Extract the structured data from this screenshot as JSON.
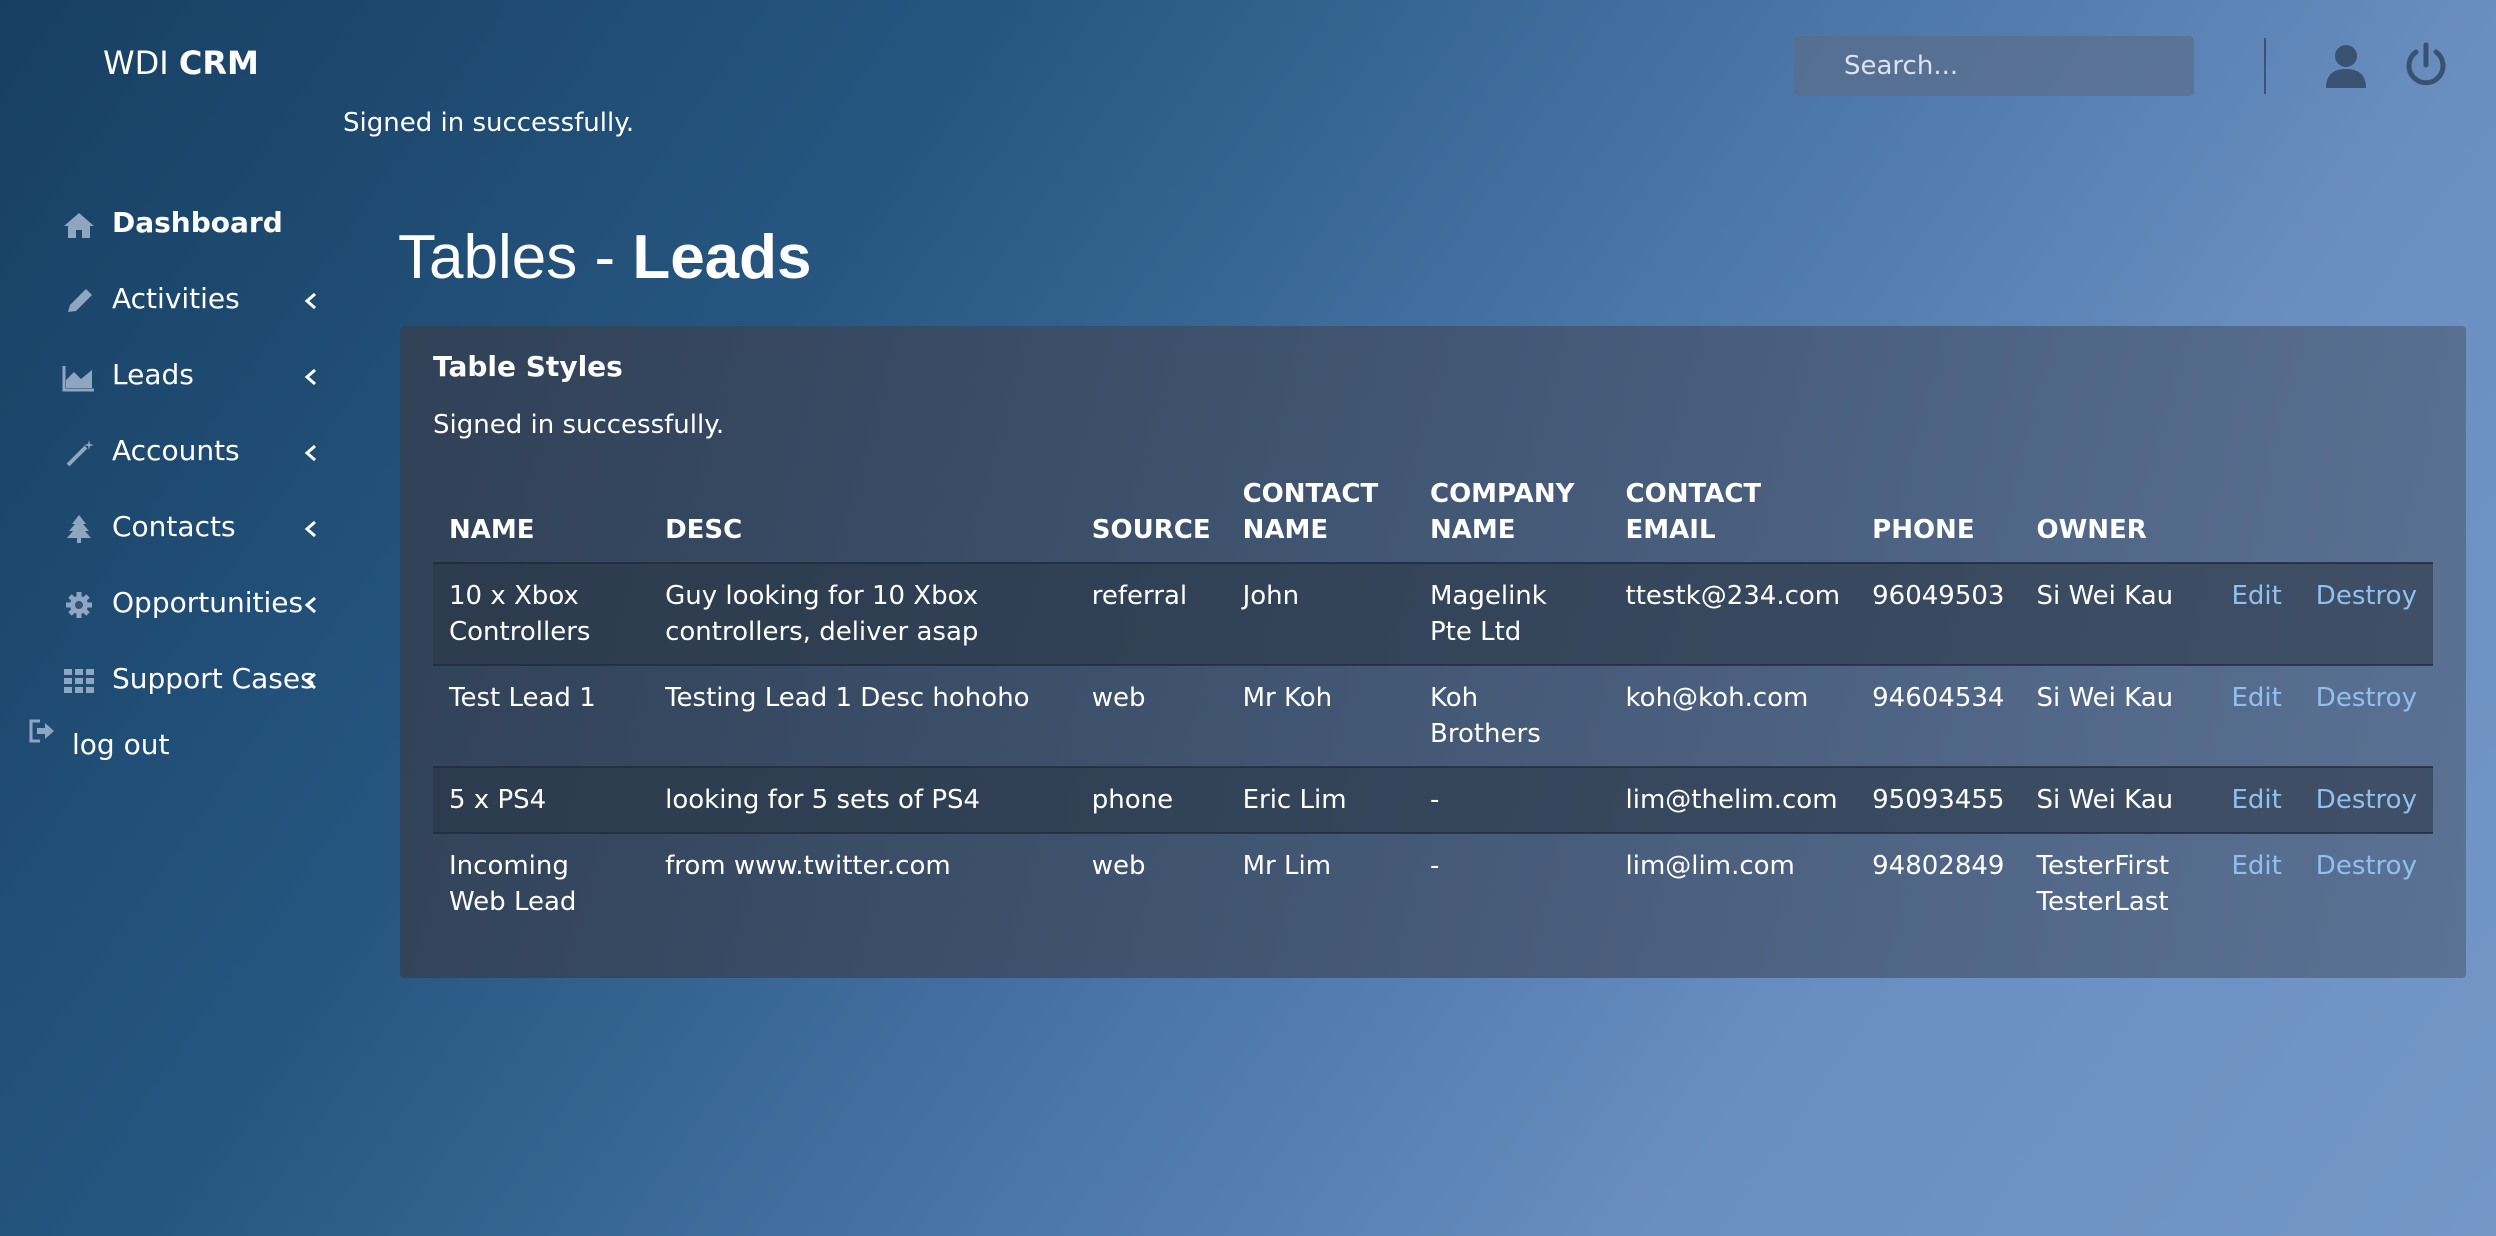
{
  "brand": {
    "prefix": "WDI ",
    "bold": "CRM"
  },
  "top_flash": "Signed in successfully.",
  "search": {
    "placeholder": "Search..."
  },
  "sidebar": {
    "items": [
      {
        "label": "Dashboard",
        "icon": "home-icon"
      },
      {
        "label": "Activities",
        "icon": "pencil-icon"
      },
      {
        "label": "Leads",
        "icon": "area-chart-icon"
      },
      {
        "label": "Accounts",
        "icon": "magic-wand-icon"
      },
      {
        "label": "Contacts",
        "icon": "tree-icon"
      },
      {
        "label": "Opportunities",
        "icon": "gear-icon"
      },
      {
        "label": "Support Cases",
        "icon": "grid-icon"
      }
    ],
    "logout": "log out"
  },
  "page_title": {
    "prefix": "Tables - ",
    "bold": "Leads"
  },
  "panel": {
    "title": "Table Styles",
    "flash": "Signed in successfully."
  },
  "table": {
    "headers": {
      "name": "NAME",
      "desc": "DESC",
      "source": "SOURCE",
      "contact_name": "CONTACT NAME",
      "company_name": "COMPANY NAME",
      "contact_email": "CONTACT EMAIL",
      "phone": "PHONE",
      "owner": "OWNER"
    },
    "rows": [
      {
        "name": "10 x Xbox Controllers",
        "desc": "Guy looking for 10 Xbox controllers, deliver asap",
        "source": "referral",
        "contact_name": "John",
        "company_name": "Magelink Pte Ltd",
        "contact_email": "ttestk@234.com",
        "phone": "96049503",
        "owner": "Si Wei Kau",
        "edit": "Edit",
        "destroy": "Destroy"
      },
      {
        "name": "Test Lead 1",
        "desc": "Testing Lead 1 Desc hohoho",
        "source": "web",
        "contact_name": "Mr Koh",
        "company_name": "Koh Brothers",
        "contact_email": "koh@koh.com",
        "phone": "94604534",
        "owner": "Si Wei Kau",
        "edit": "Edit",
        "destroy": "Destroy"
      },
      {
        "name": "5 x PS4",
        "desc": "looking for 5 sets of PS4",
        "source": "phone",
        "contact_name": "Eric Lim",
        "company_name": "-",
        "contact_email": "lim@thelim.com",
        "phone": "95093455",
        "owner": "Si Wei Kau",
        "edit": "Edit",
        "destroy": "Destroy"
      },
      {
        "name": "Incoming Web Lead",
        "desc": "from www.twitter.com",
        "source": "web",
        "contact_name": "Mr Lim",
        "company_name": "-",
        "contact_email": "lim@lim.com",
        "phone": "94802849",
        "owner": "TesterFirst TesterLast",
        "edit": "Edit",
        "destroy": "Destroy"
      }
    ]
  },
  "colors": {
    "link": "#8fc0f0",
    "text": "#ffffff"
  }
}
